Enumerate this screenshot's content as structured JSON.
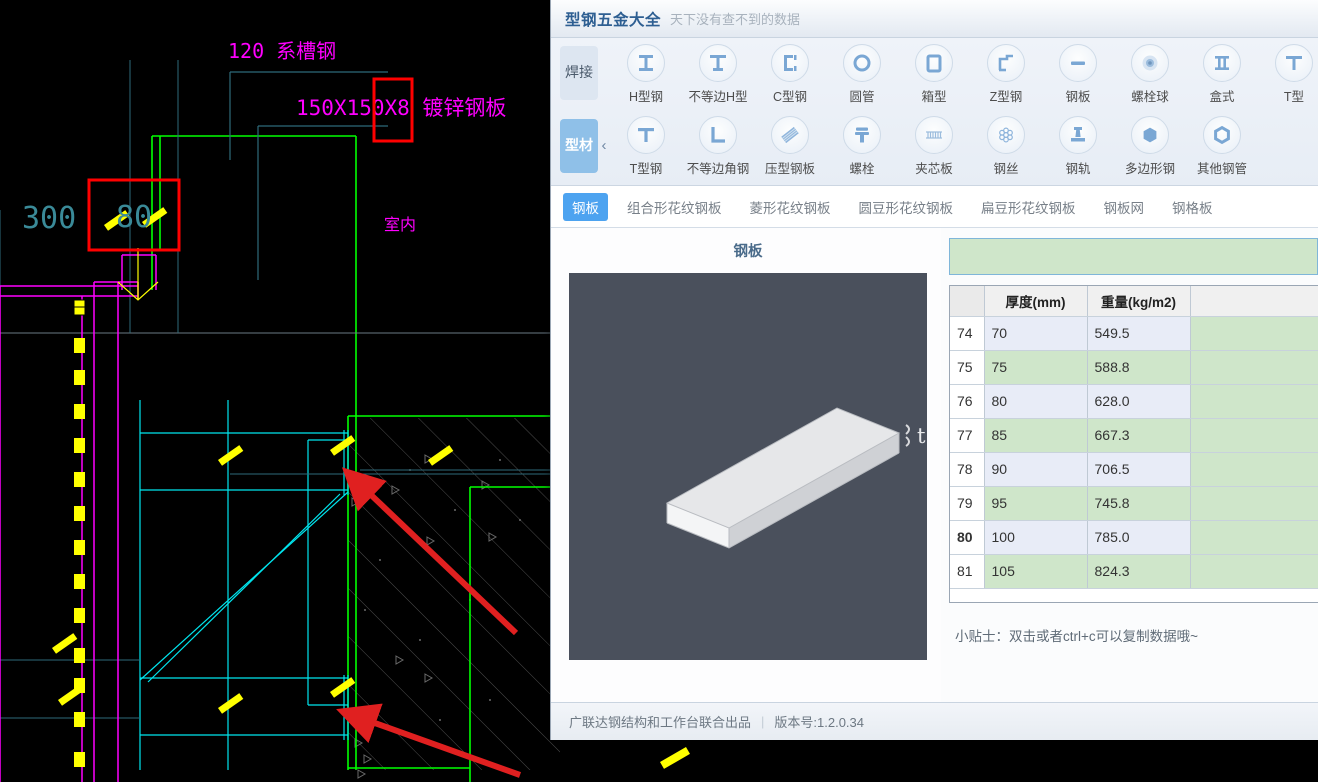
{
  "app": {
    "title": "型钢五金大全",
    "subtitle": "天下没有查不到的数据"
  },
  "ribbon": {
    "category_welding": "焊接",
    "category_profile": "型材",
    "collapse_icon": "‹",
    "row1": [
      {
        "label": "H型钢",
        "icon": "h-beam-icon"
      },
      {
        "label": "不等边H型",
        "icon": "unequal-h-beam-icon"
      },
      {
        "label": "C型钢",
        "icon": "c-channel-icon"
      },
      {
        "label": "圆管",
        "icon": "round-tube-icon"
      },
      {
        "label": "箱型",
        "icon": "box-section-icon"
      },
      {
        "label": "Z型钢",
        "icon": "z-section-icon"
      },
      {
        "label": "钢板",
        "icon": "steel-plate-icon"
      },
      {
        "label": "螺栓球",
        "icon": "bolt-ball-icon"
      },
      {
        "label": "盒式",
        "icon": "box-type-icon"
      },
      {
        "label": "T型",
        "icon": "t-type-icon"
      }
    ],
    "row2": [
      {
        "label": "T型钢",
        "icon": "t-beam-icon"
      },
      {
        "label": "不等边角钢",
        "icon": "unequal-angle-icon"
      },
      {
        "label": "压型钢板",
        "icon": "profiled-sheet-icon"
      },
      {
        "label": "螺栓",
        "icon": "bolt-icon"
      },
      {
        "label": "夹芯板",
        "icon": "sandwich-panel-icon"
      },
      {
        "label": "钢丝",
        "icon": "steel-wire-icon"
      },
      {
        "label": "钢轨",
        "icon": "rail-icon"
      },
      {
        "label": "多边形钢",
        "icon": "polygon-steel-icon"
      },
      {
        "label": "其他钢管",
        "icon": "other-tube-icon"
      }
    ]
  },
  "tabs": [
    {
      "label": "钢板",
      "active": true
    },
    {
      "label": "组合形花纹钢板",
      "active": false
    },
    {
      "label": "菱形花纹钢板",
      "active": false
    },
    {
      "label": "圆豆形花纹钢板",
      "active": false
    },
    {
      "label": "扁豆形花纹钢板",
      "active": false
    },
    {
      "label": "钢板网",
      "active": false
    },
    {
      "label": "钢格板",
      "active": false
    }
  ],
  "preview": {
    "title": "钢板",
    "dimension_label": "t"
  },
  "search": {
    "value": "",
    "placeholder": ""
  },
  "table": {
    "columns": [
      "",
      "厚度(mm)",
      "重量(kg/m2)",
      ""
    ],
    "rows": [
      {
        "index": "74",
        "thickness": "70",
        "weight": "549.5",
        "selected": false
      },
      {
        "index": "75",
        "thickness": "75",
        "weight": "588.8",
        "selected": false
      },
      {
        "index": "76",
        "thickness": "80",
        "weight": "628.0",
        "selected": false
      },
      {
        "index": "77",
        "thickness": "85",
        "weight": "667.3",
        "selected": false
      },
      {
        "index": "78",
        "thickness": "90",
        "weight": "706.5",
        "selected": false
      },
      {
        "index": "79",
        "thickness": "95",
        "weight": "745.8",
        "selected": false
      },
      {
        "index": "80",
        "thickness": "100",
        "weight": "785.0",
        "selected": true
      },
      {
        "index": "81",
        "thickness": "105",
        "weight": "824.3",
        "selected": false
      }
    ]
  },
  "tip": "小贴士：双击或者ctrl+c可以复制数据哦~",
  "status": {
    "producer": "广联达钢结构和工作台联合出品",
    "separator": "|",
    "version": "版本号:1.2.0.34"
  },
  "cad": {
    "label_channel": "120系槽钢",
    "label_plate": "150X150X8 镀锌钢板",
    "label_indoor": "室内",
    "dim_300": "300",
    "dim_80": "80",
    "colors": {
      "magenta": "#ff00ff",
      "cyan": "#00ffff",
      "green": "#00ff00",
      "yellow": "#ffff00",
      "red_highlight": "#ff0000",
      "background": "#000000"
    }
  }
}
